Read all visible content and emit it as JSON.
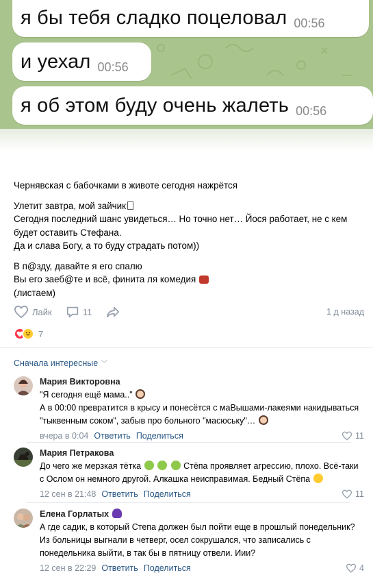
{
  "chat": {
    "messages": [
      {
        "text": "я бы тебя сладко поцеловал",
        "time": "00:56"
      },
      {
        "text": "и уехал",
        "time": "00:56"
      },
      {
        "text": "я об этом буду очень жалеть",
        "time": "00:56"
      }
    ]
  },
  "post": {
    "paragraphs": [
      [
        "Чернявская с бабочками в животе сегодня нажрётся"
      ],
      [
        "Улетит завтра, мой зайчик",
        "Сегодня последний шанс увидеться… Но точно нет… Йося работает, не с кем будет оставить Стефана.",
        "Да и слава Богу, а то буду страдать потом))"
      ],
      [
        "В п@зду, давайте я его спалю",
        "Вы его заеб@те и всё, финита ля комедия",
        "(листаем)"
      ]
    ],
    "like_label": "Лайк",
    "comments_count": "11",
    "posted_ago": "1 д назад",
    "reactions_count": "7"
  },
  "comments_section": {
    "sort_label": "Сначала интересные",
    "reply_label": "Ответить",
    "share_label": "Поделиться",
    "comments": [
      {
        "author": "Мария Викторовна",
        "text_a": "\"Я сегодня ещё мама..\"",
        "text_b": "А в 00:00 превратится в крысу и понесётся с маВышами-лакеями накидываться \"тыквенным соком\", забыв про больного \"масюську\"…",
        "date": "вчера в 0:04",
        "likes": "11"
      },
      {
        "author": "Мария Петракова",
        "text_a": "До чего же мерзкая тётка",
        "text_b": "Стёпа проявляет агрессию, плохо. Всё-таки с Ослом он немного другой. Алкашка неисправимая. Бедный Стёпа",
        "date": "12 сен в 21:48",
        "likes": "11"
      },
      {
        "author": "Елена Горлатых",
        "text_a": "А где садик, в который Степа должен был пойти еще в прошлый понедельник? Из больницы выгнали в четверг, осел сокрушался, что записались с понедельника выйти, в так бы в пятницу отвели. Иии?",
        "date": "12 сен в 22:29",
        "likes": "4"
      }
    ]
  }
}
